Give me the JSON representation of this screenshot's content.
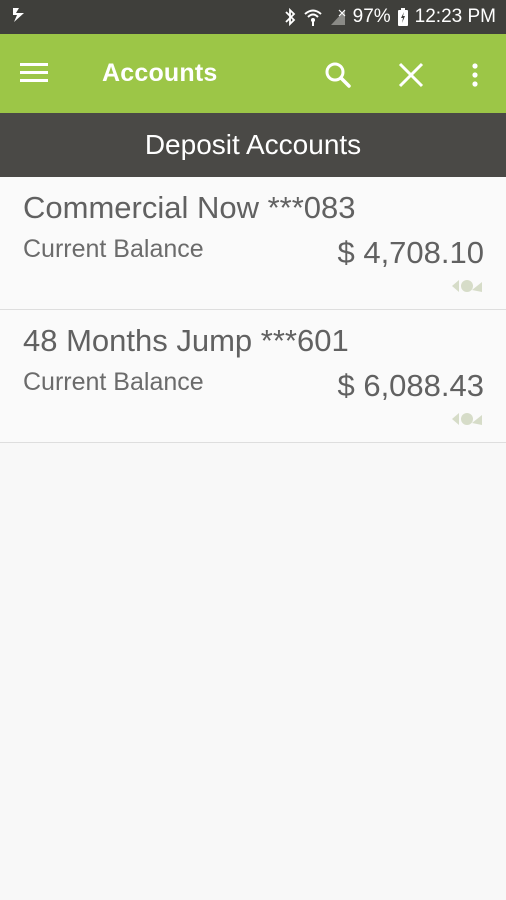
{
  "status_bar": {
    "app_icon": "notification-icon",
    "bluetooth_icon": "bluetooth-icon",
    "wifi_icon": "wifi-icon",
    "signal_icon": "signal-icon",
    "battery_percent": "97%",
    "battery_icon": "battery-icon",
    "time": "12:23 PM"
  },
  "app_bar": {
    "title": "Accounts",
    "menu_icon": "hamburger-menu-icon",
    "search_icon": "search-icon",
    "close_icon": "close-icon",
    "more_icon": "more-vert-icon",
    "color": "#9cc647"
  },
  "section": {
    "title": "Deposit Accounts"
  },
  "accounts": [
    {
      "name": "Commercial Now ***083",
      "balance_label": "Current Balance",
      "balance": "$ 4,708.10",
      "icon": "money-icon"
    },
    {
      "name": "48 Months Jump ***601",
      "balance_label": "Current Balance",
      "balance": "$ 6,088.43",
      "icon": "money-icon"
    }
  ]
}
